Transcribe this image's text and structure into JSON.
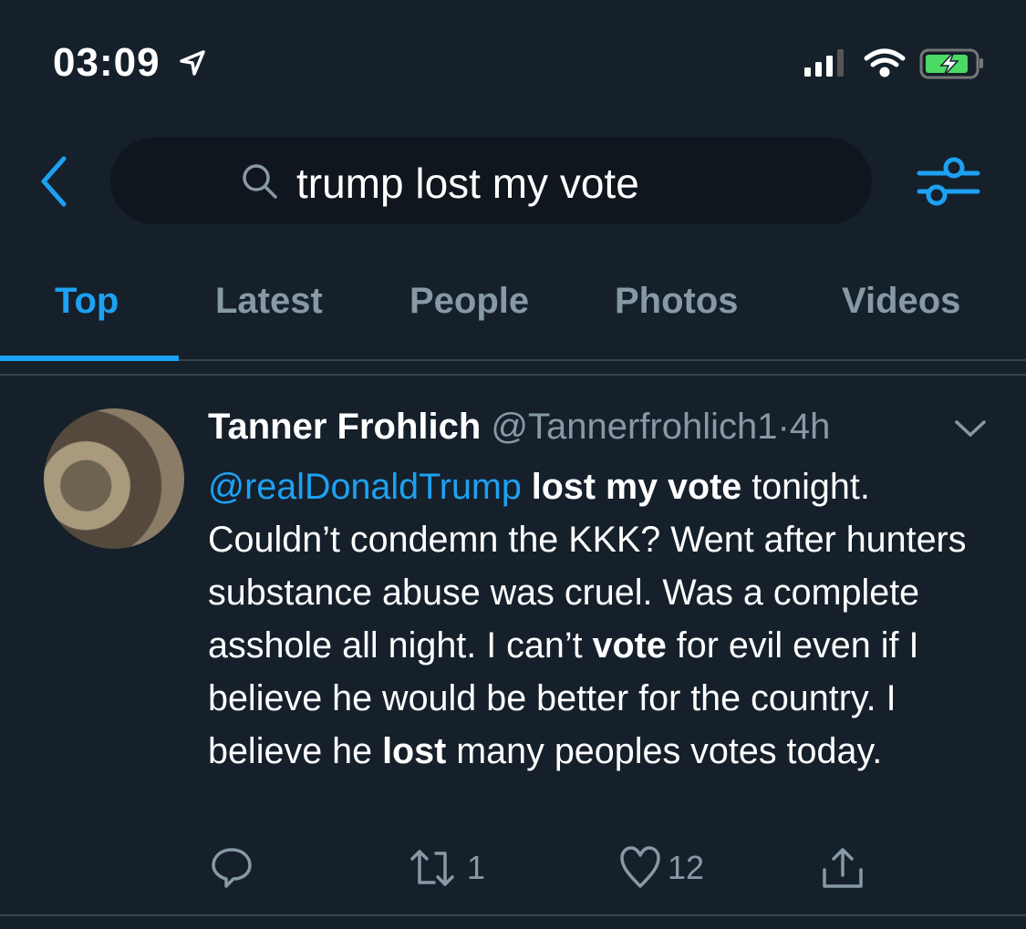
{
  "status_bar": {
    "time": "03:09",
    "icons": [
      "location-arrow-icon",
      "signal-icon",
      "wifi-icon",
      "battery-charging-icon"
    ]
  },
  "search": {
    "query": "trump lost my vote",
    "icons": [
      "back-chevron-icon",
      "search-icon",
      "filter-sliders-icon"
    ]
  },
  "tabs": [
    {
      "label": "Top",
      "active": true
    },
    {
      "label": "Latest"
    },
    {
      "label": "People"
    },
    {
      "label": "Photos"
    },
    {
      "label": "Videos"
    }
  ],
  "colors": {
    "background": "#15202b",
    "accent": "#1da1f2",
    "muted": "#8899a6"
  },
  "tweet": {
    "name": "Tanner Frohlich",
    "handle": "@Tannerfrohlich1",
    "separator": "·",
    "time": "4h",
    "segments": [
      {
        "text": "@realDonaldTrump",
        "style": "mention"
      },
      {
        "text": " ",
        "style": "normal"
      },
      {
        "text": "lost my vote",
        "style": "bold"
      },
      {
        "text": " tonight. Couldn’t condemn the KKK? Went after hunters substance abuse was cruel. Was a complete asshole all night. I can’t ",
        "style": "normal"
      },
      {
        "text": "vote",
        "style": "bold"
      },
      {
        "text": " for evil even if I believe he would be better for the country. I believe he ",
        "style": "normal"
      },
      {
        "text": "lost",
        "style": "bold"
      },
      {
        "text": " many peoples votes today.",
        "style": "normal"
      }
    ],
    "actions": {
      "replies": "",
      "retweets": "1",
      "likes": "12"
    }
  }
}
